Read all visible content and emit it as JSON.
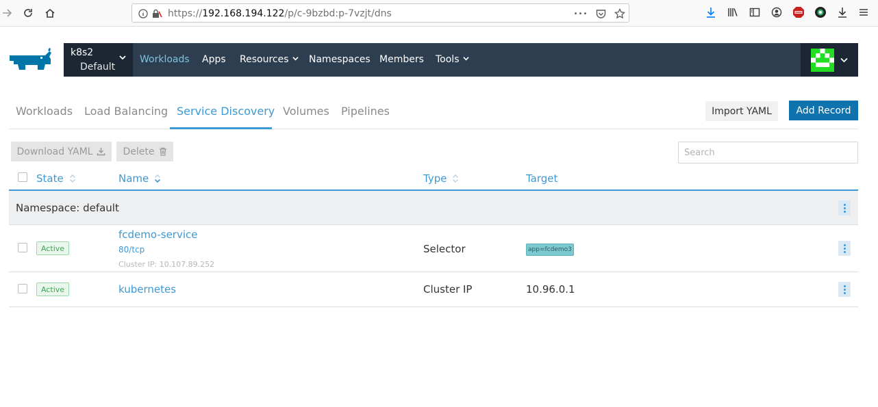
{
  "browser": {
    "url_prefix": "https://",
    "url_host": "192.168.194.122",
    "url_path": "/p/c-9bzbd:p-7vzjt/dns",
    "more_glyph": "•••"
  },
  "header": {
    "cluster_name": "k8s2",
    "project_name": "Default",
    "nav": [
      {
        "label": "Workloads"
      },
      {
        "label": "Apps"
      },
      {
        "label": "Resources"
      },
      {
        "label": "Namespaces"
      },
      {
        "label": "Members"
      },
      {
        "label": "Tools"
      }
    ]
  },
  "tabs": [
    {
      "label": "Workloads"
    },
    {
      "label": "Load Balancing"
    },
    {
      "label": "Service Discovery"
    },
    {
      "label": "Volumes"
    },
    {
      "label": "Pipelines"
    }
  ],
  "actions": {
    "import_yaml": "Import YAML",
    "add_record": "Add Record",
    "download_yaml": "Download YAML",
    "delete": "Delete",
    "search_placeholder": "Search"
  },
  "table": {
    "columns": [
      "State",
      "Name",
      "Type",
      "Target"
    ],
    "group_label": "Namespace: default",
    "rows": [
      {
        "state": "Active",
        "name": "fcdemo-service",
        "port": "80/tcp",
        "cluster_ip": "Cluster IP: 10.107.89.252",
        "type": "Selector",
        "target": "app=fcdemo3"
      },
      {
        "state": "Active",
        "name": "kubernetes",
        "type": "Cluster IP",
        "target": "10.96.0.1"
      }
    ]
  },
  "colors": {
    "header_bg": "#2d3e50",
    "accent": "#3d98d3",
    "primary_button": "#0f74ad",
    "active_badge": "#3ea452",
    "selector_tag": "#7ec8cf"
  }
}
